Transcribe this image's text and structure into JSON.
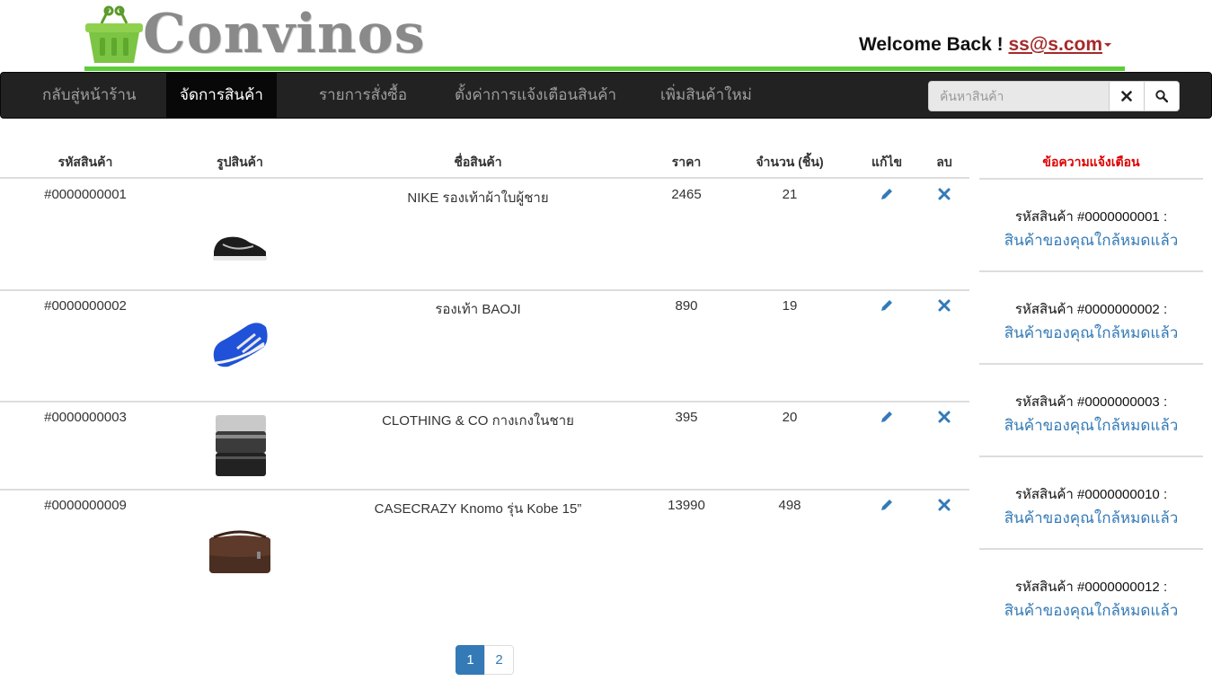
{
  "header": {
    "brand": "Convinos",
    "welcome_text": "Welcome Back !",
    "user_email": "ss@s.com"
  },
  "nav": {
    "items": [
      {
        "label": "กลับสู่หน้าร้าน"
      },
      {
        "label": "จัดการสินค้า"
      },
      {
        "label": "รายการสั่งซื้อ"
      },
      {
        "label": "ตั้งค่าการแจ้งเตือนสินค้า"
      },
      {
        "label": "เพิ่มสินค้าใหม่"
      }
    ],
    "active_index": 1,
    "search_placeholder": "ค้นหาสินค้า"
  },
  "table": {
    "headers": [
      "รหัสสินค้า",
      "รูปสินค้า",
      "ชื่อสินค้า",
      "ราคา",
      "จำนวน (ชิ้น)",
      "แก้ไข",
      "ลบ"
    ],
    "rows": [
      {
        "id": "#0000000001",
        "name": "NIKE รองเท้าผ้าใบผู้ชาย",
        "price": "2465",
        "qty": "21",
        "image": "black-sneaker-image"
      },
      {
        "id": "#0000000002",
        "name": "รองเท้า BAOJI",
        "price": "890",
        "qty": "19",
        "image": "blue-sneaker-image"
      },
      {
        "id": "#0000000003",
        "name": "CLOTHING & CO กางเกงในชาย",
        "price": "395",
        "qty": "20",
        "image": "underwear-image"
      },
      {
        "id": "#0000000009",
        "name": "CASECRAZY Knomo รุ่น Kobe 15”",
        "price": "13990",
        "qty": "498",
        "image": "messenger-bag-image"
      }
    ]
  },
  "notifications": {
    "title": "ข้อความแจ้งเตือน",
    "items": [
      {
        "code": "รหัสสินค้า #0000000001 :",
        "message": "สินค้าของคุณใกล้หมดแล้ว"
      },
      {
        "code": "รหัสสินค้า #0000000002 :",
        "message": "สินค้าของคุณใกล้หมดแล้ว"
      },
      {
        "code": "รหัสสินค้า #0000000003 :",
        "message": "สินค้าของคุณใกล้หมดแล้ว"
      },
      {
        "code": "รหัสสินค้า #0000000010 :",
        "message": "สินค้าของคุณใกล้หมดแล้ว"
      },
      {
        "code": "รหัสสินค้า #0000000012 :",
        "message": "สินค้าของคุณใกล้หมดแล้ว"
      }
    ]
  },
  "pagination": {
    "pages": [
      "1",
      "2"
    ],
    "current": "1"
  },
  "colors": {
    "accent_green": "#5ccc3a",
    "navbar": "#222222",
    "link_blue": "#337ab7",
    "alert_red": "#e00000",
    "email_red": "#a52a2a"
  }
}
